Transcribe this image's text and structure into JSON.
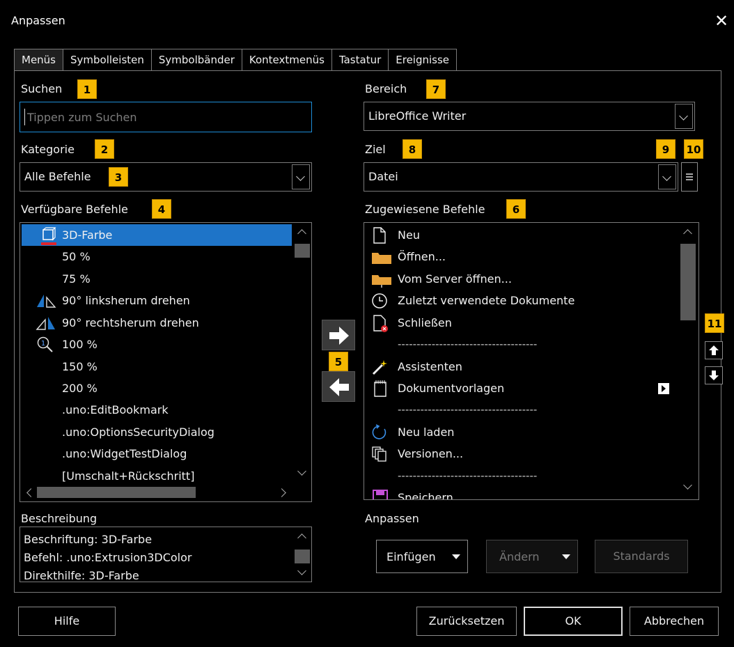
{
  "window": {
    "title": "Anpassen",
    "close_glyph": "✕"
  },
  "tabs": [
    {
      "label": "Menüs",
      "active": true
    },
    {
      "label": "Symbolleisten",
      "active": false
    },
    {
      "label": "Symbolbänder",
      "active": false
    },
    {
      "label": "Kontextmenüs",
      "active": false
    },
    {
      "label": "Tastatur",
      "active": false
    },
    {
      "label": "Ereignisse",
      "active": false
    }
  ],
  "badges": [
    "1",
    "2",
    "3",
    "4",
    "5",
    "6",
    "7",
    "8",
    "9",
    "10",
    "11"
  ],
  "search": {
    "label": "Suchen",
    "placeholder": "Tippen zum Suchen"
  },
  "category": {
    "label": "Kategorie",
    "value": "Alle Befehle"
  },
  "available": {
    "label": "Verfügbare Befehle",
    "items": [
      "3D-Farbe",
      "50 %",
      "75 %",
      "90° linksherum drehen",
      "90° rechtsherum drehen",
      "100 %",
      "150 %",
      "200 %",
      ".uno:EditBookmark",
      ".uno:OptionsSecurityDialog",
      ".uno:WidgetTestDialog",
      "[Umschalt+Rückschritt]"
    ],
    "selected_index": 0
  },
  "description": {
    "label": "Beschreibung",
    "lines": [
      "Beschriftung: 3D-Farbe",
      "Befehl: .uno:Extrusion3DColor",
      "Direkthilfe: 3D-Farbe"
    ]
  },
  "scope": {
    "label": "Bereich",
    "value": "LibreOffice Writer"
  },
  "target": {
    "label": "Ziel",
    "value": "Datei"
  },
  "assigned": {
    "label": "Zugewiesene Befehle",
    "items": [
      "Neu",
      "Öffnen...",
      "Vom Server öffnen...",
      "Zuletzt verwendete Dokumente",
      "Schließen",
      "-------------------------------------",
      "Assistenten",
      "Dokumentvorlagen",
      "-------------------------------------",
      "Neu laden",
      "Versionen...",
      "-------------------------------------",
      "Speichern"
    ]
  },
  "customize": {
    "label": "Anpassen",
    "insert": "Einfügen",
    "modify": "Ändern",
    "defaults": "Standards"
  },
  "footer": {
    "help": "Hilfe",
    "reset": "Zurücksetzen",
    "ok": "OK",
    "cancel": "Abbrechen"
  },
  "colors": {
    "accent": "#1e74c8",
    "badge": "#f5b800",
    "focus_border": "#1e8ed8",
    "folder": "#e8a23a",
    "save": "#c34fd6"
  }
}
